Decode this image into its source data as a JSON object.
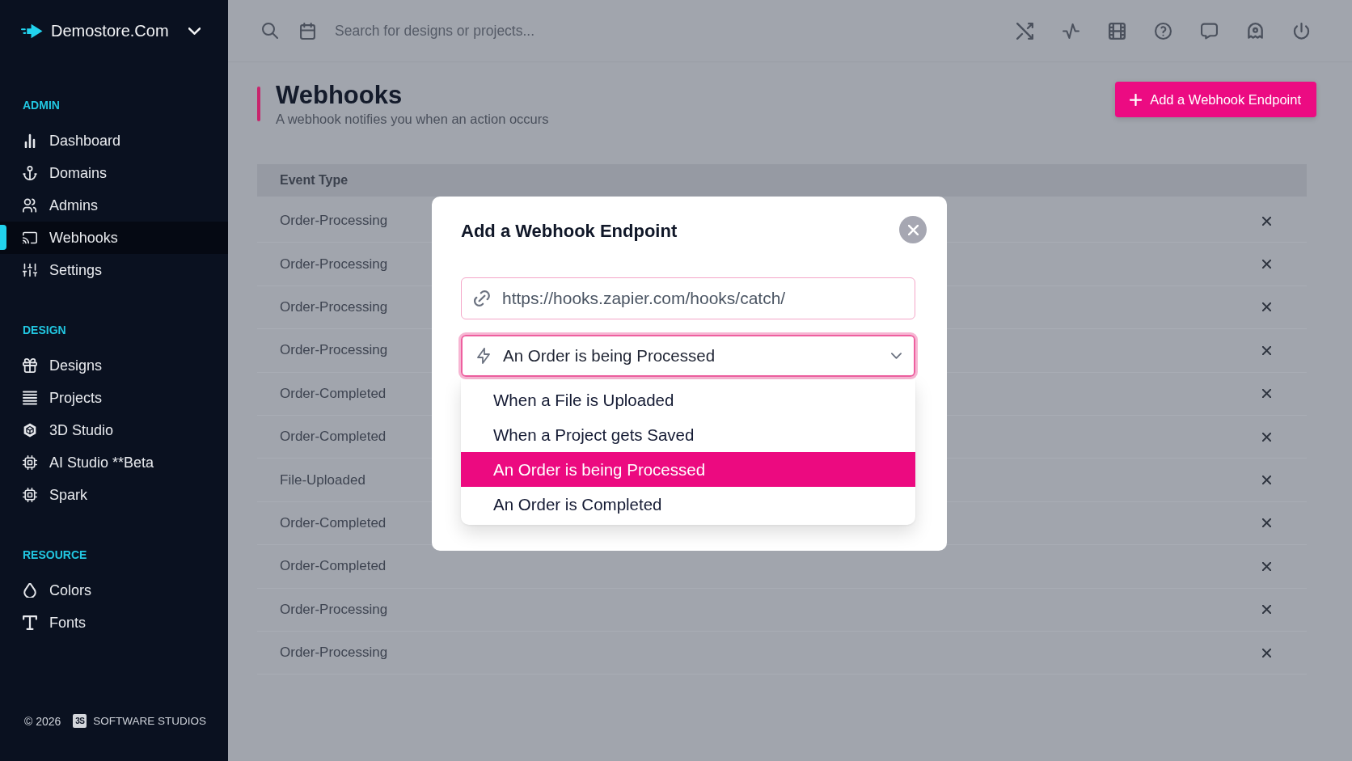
{
  "sidebar": {
    "brand": {
      "name": "Demostore.Com"
    },
    "sections": [
      {
        "title": "ADMIN",
        "items": [
          {
            "label": "Dashboard",
            "selected": false
          },
          {
            "label": "Domains",
            "selected": false
          },
          {
            "label": "Admins",
            "selected": false
          },
          {
            "label": "Webhooks",
            "selected": true
          },
          {
            "label": "Settings",
            "selected": false
          }
        ]
      },
      {
        "title": "DESIGN",
        "items": [
          {
            "label": "Designs",
            "selected": false
          },
          {
            "label": "Projects",
            "selected": false
          },
          {
            "label": "3D Studio",
            "selected": false
          },
          {
            "label": "AI Studio **Beta",
            "selected": false
          },
          {
            "label": "Spark",
            "selected": false
          }
        ]
      },
      {
        "title": "RESOURCE",
        "items": [
          {
            "label": "Colors",
            "selected": false
          },
          {
            "label": "Fonts",
            "selected": false
          }
        ]
      }
    ],
    "footer": {
      "copyright": "© 2026",
      "badge": "3S",
      "company": "SOFTWARE STUDIOS"
    }
  },
  "topbar": {
    "search": {
      "placeholder": "Search for designs or projects..."
    }
  },
  "page": {
    "title": "Webhooks",
    "subtitle": "A webhook notifies you when an action occurs",
    "add_button": "Add a Webhook Endpoint"
  },
  "table": {
    "columns": [
      "Event Type"
    ],
    "rows": [
      {
        "event_type": "Order-Processing"
      },
      {
        "event_type": "Order-Processing"
      },
      {
        "event_type": "Order-Processing"
      },
      {
        "event_type": "Order-Processing"
      },
      {
        "event_type": "Order-Completed"
      },
      {
        "event_type": "Order-Completed"
      },
      {
        "event_type": "File-Uploaded"
      },
      {
        "event_type": "Order-Completed"
      },
      {
        "event_type": "Order-Completed"
      },
      {
        "event_type": "Order-Processing"
      },
      {
        "event_type": "Order-Processing"
      }
    ]
  },
  "modal": {
    "title": "Add a Webhook Endpoint",
    "url_field": {
      "value": "https://hooks.zapier.com/hooks/catch/"
    },
    "event_select": {
      "value": "An Order is being Processed",
      "expanded": true,
      "options": [
        {
          "label": "When a File is Uploaded",
          "selected": false
        },
        {
          "label": "When a Project gets Saved",
          "selected": false
        },
        {
          "label": "An Order is being Processed",
          "selected": true
        },
        {
          "label": "An Order is Completed",
          "selected": false
        }
      ]
    }
  }
}
